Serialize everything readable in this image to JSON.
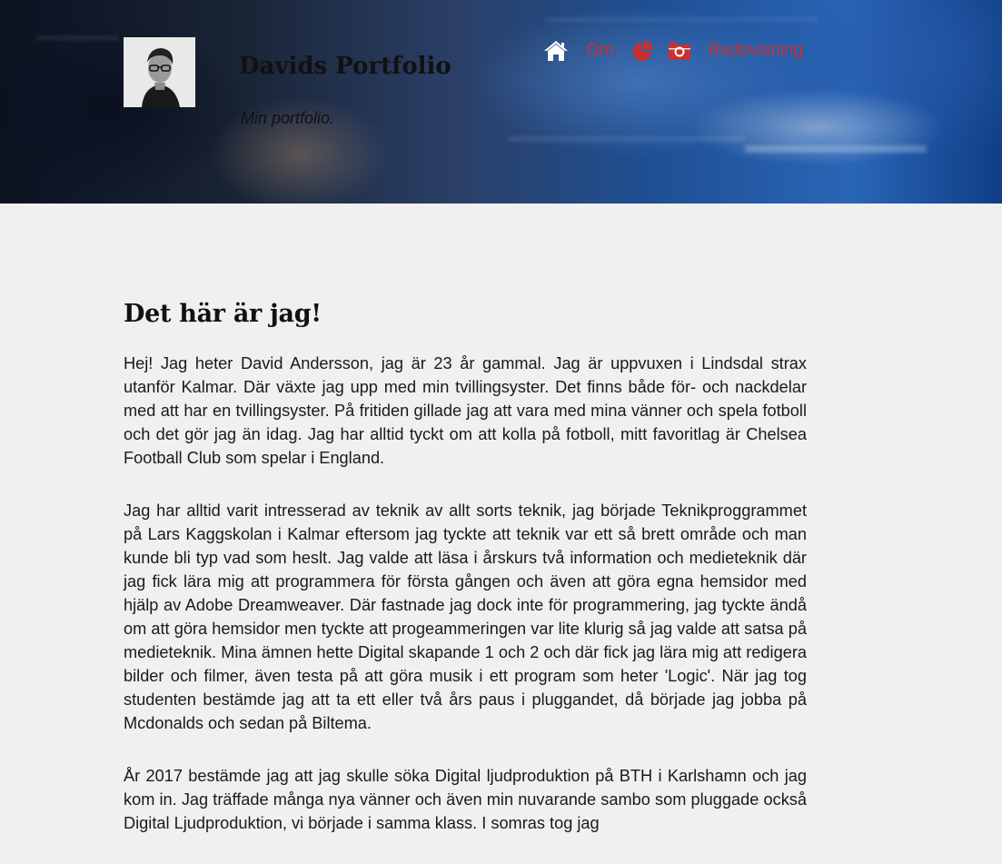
{
  "header": {
    "title": "Davids Portfolio",
    "subtitle": "Min portfolio.",
    "accent_color": "#c8312f"
  },
  "nav": {
    "items": [
      {
        "type": "icon",
        "icon": "home-icon"
      },
      {
        "type": "text",
        "label": "Om"
      },
      {
        "type": "icon",
        "icon": "pie-chart-icon"
      },
      {
        "type": "icon",
        "icon": "camera-icon"
      },
      {
        "type": "text",
        "label": "Redovisning"
      }
    ]
  },
  "main": {
    "heading": "Det här är jag!",
    "paragraphs": [
      "Hej! Jag heter David Andersson, jag är 23 år gammal. Jag är uppvuxen i Lindsdal strax utanför Kalmar. Där växte jag upp med min tvillingsyster. Det finns både för- och nackdelar med att har en tvillingsyster. På fritiden gillade jag att vara med mina vänner och spela fotboll och det gör jag än idag. Jag har alltid tyckt om att kolla på fotboll, mitt favoritlag är Chelsea Football Club som spelar i England.",
      "Jag har alltid varit intresserad av teknik av allt sorts teknik, jag började Teknikproggrammet på Lars Kaggskolan i Kalmar eftersom jag tyckte att teknik var ett så brett område och man kunde bli typ vad som heslt. Jag valde att läsa i årskurs två information och medieteknik där jag fick lära mig att programmera för första gången och även att göra egna hemsidor med hjälp av Adobe Dreamweaver. Där fastnade jag dock inte för programmering, jag tyckte ändå om att göra hemsidor men tyckte att progeammeringen var lite klurig så jag valde att satsa på medieteknik. Mina ämnen hette Digital skapande 1 och 2 och där fick jag lära mig att redigera bilder och filmer, även testa på att göra musik i ett program som heter 'Logic'. När jag tog studenten bestämde jag att ta ett eller två års paus i pluggandet, då började jag jobba på Mcdonalds och sedan på Biltema.",
      "År 2017 bestämde jag att jag skulle söka Digital ljudproduktion på BTH i Karlshamn och jag kom in. Jag träffade många nya vänner och även min nuvarande sambo som pluggade också Digital Ljudproduktion, vi började i samma klass. I somras tog jag"
    ]
  }
}
